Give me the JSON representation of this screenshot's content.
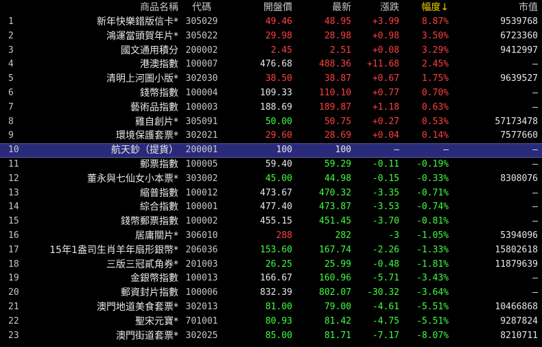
{
  "header": {
    "name": "商品名稱",
    "code": "代碼",
    "open": "開盤價",
    "last": "最新",
    "change": "漲跌",
    "pct": "幅度↓",
    "mv": "市值"
  },
  "colors": {
    "up": "#ff4040",
    "down": "#40ff40",
    "flat": "#e8e8e8",
    "selected_row": "#2a2a7a"
  },
  "rows": [
    {
      "idx": "1",
      "name": "新年快樂錯版信卡*",
      "code": "305029",
      "open": "49.46",
      "open_c": "red",
      "last": "48.95",
      "last_c": "red",
      "chg": "+3.99",
      "chg_c": "red",
      "pct": "8.87%",
      "pct_c": "red",
      "mv": "9539768"
    },
    {
      "idx": "2",
      "name": "鴻運當頭賀年片*",
      "code": "305022",
      "open": "29.98",
      "open_c": "red",
      "last": "28.98",
      "last_c": "red",
      "chg": "+0.98",
      "chg_c": "red",
      "pct": "3.50%",
      "pct_c": "red",
      "mv": "6723360"
    },
    {
      "idx": "3",
      "name": "國文通用積分",
      "code": "200002",
      "open": "2.45",
      "open_c": "red",
      "last": "2.51",
      "last_c": "red",
      "chg": "+0.08",
      "chg_c": "red",
      "pct": "3.29%",
      "pct_c": "red",
      "mv": "9412997"
    },
    {
      "idx": "4",
      "name": "港澳指數",
      "code": "100007",
      "open": "476.68",
      "open_c": "white",
      "last": "488.36",
      "last_c": "red",
      "chg": "+11.68",
      "chg_c": "red",
      "pct": "2.45%",
      "pct_c": "red",
      "mv": "—"
    },
    {
      "idx": "5",
      "name": "清明上河圖小版*",
      "code": "302030",
      "open": "38.50",
      "open_c": "red",
      "last": "38.87",
      "last_c": "red",
      "chg": "+0.67",
      "chg_c": "red",
      "pct": "1.75%",
      "pct_c": "red",
      "mv": "9639527"
    },
    {
      "idx": "6",
      "name": "錢幣指數",
      "code": "100004",
      "open": "109.33",
      "open_c": "white",
      "last": "110.10",
      "last_c": "red",
      "chg": "+0.77",
      "chg_c": "red",
      "pct": "0.70%",
      "pct_c": "red",
      "mv": "—"
    },
    {
      "idx": "7",
      "name": "藝術品指數",
      "code": "100003",
      "open": "188.69",
      "open_c": "white",
      "last": "189.87",
      "last_c": "red",
      "chg": "+1.18",
      "chg_c": "red",
      "pct": "0.63%",
      "pct_c": "red",
      "mv": "—"
    },
    {
      "idx": "8",
      "name": "雞自創片*",
      "code": "305091",
      "open": "50.00",
      "open_c": "green",
      "last": "50.75",
      "last_c": "red",
      "chg": "+0.27",
      "chg_c": "red",
      "pct": "0.53%",
      "pct_c": "red",
      "mv": "57173478"
    },
    {
      "idx": "9",
      "name": "環境保護套票*",
      "code": "302021",
      "open": "29.60",
      "open_c": "red",
      "last": "28.69",
      "last_c": "red",
      "chg": "+0.04",
      "chg_c": "red",
      "pct": "0.14%",
      "pct_c": "red",
      "mv": "7577660"
    },
    {
      "idx": "10",
      "name": "航天鈔（提貨）",
      "code": "200001",
      "open": "100",
      "open_c": "white",
      "last": "100",
      "last_c": "white",
      "chg": "—",
      "chg_c": "white",
      "pct": "—",
      "pct_c": "white",
      "mv": "—",
      "selected": true
    },
    {
      "idx": "11",
      "name": "郵票指數",
      "code": "100005",
      "open": "59.40",
      "open_c": "white",
      "last": "59.29",
      "last_c": "green",
      "chg": "-0.11",
      "chg_c": "green",
      "pct": "-0.19%",
      "pct_c": "green",
      "mv": "—"
    },
    {
      "idx": "12",
      "name": "董永與七仙女小本票*",
      "code": "303002",
      "open": "45.00",
      "open_c": "green",
      "last": "44.98",
      "last_c": "green",
      "chg": "-0.15",
      "chg_c": "green",
      "pct": "-0.33%",
      "pct_c": "green",
      "mv": "8308076"
    },
    {
      "idx": "13",
      "name": "縮普指數",
      "code": "100012",
      "open": "473.67",
      "open_c": "white",
      "last": "470.32",
      "last_c": "green",
      "chg": "-3.35",
      "chg_c": "green",
      "pct": "-0.71%",
      "pct_c": "green",
      "mv": "—"
    },
    {
      "idx": "14",
      "name": "綜合指數",
      "code": "100001",
      "open": "477.40",
      "open_c": "white",
      "last": "473.87",
      "last_c": "green",
      "chg": "-3.53",
      "chg_c": "green",
      "pct": "-0.74%",
      "pct_c": "green",
      "mv": "—"
    },
    {
      "idx": "15",
      "name": "錢幣郵票指數",
      "code": "100002",
      "open": "455.15",
      "open_c": "white",
      "last": "451.45",
      "last_c": "green",
      "chg": "-3.70",
      "chg_c": "green",
      "pct": "-0.81%",
      "pct_c": "green",
      "mv": "—"
    },
    {
      "idx": "16",
      "name": "居庸關片*",
      "code": "306010",
      "open": "288",
      "open_c": "red",
      "last": "282",
      "last_c": "green",
      "chg": "-3",
      "chg_c": "green",
      "pct": "-1.05%",
      "pct_c": "green",
      "mv": "5394096"
    },
    {
      "idx": "17",
      "name": "15年1盎司生肖羊年扇形銀幣*",
      "code": "206036",
      "open": "153.60",
      "open_c": "green",
      "last": "167.74",
      "last_c": "green",
      "chg": "-2.26",
      "chg_c": "green",
      "pct": "-1.33%",
      "pct_c": "green",
      "mv": "15802618"
    },
    {
      "idx": "18",
      "name": "三版三冠貳角券*",
      "code": "201003",
      "open": "26.25",
      "open_c": "green",
      "last": "25.99",
      "last_c": "green",
      "chg": "-0.48",
      "chg_c": "green",
      "pct": "-1.81%",
      "pct_c": "green",
      "mv": "11879639"
    },
    {
      "idx": "19",
      "name": "金銀幣指數",
      "code": "100013",
      "open": "166.67",
      "open_c": "white",
      "last": "160.96",
      "last_c": "green",
      "chg": "-5.71",
      "chg_c": "green",
      "pct": "-3.43%",
      "pct_c": "green",
      "mv": "—"
    },
    {
      "idx": "20",
      "name": "郵資封片指數",
      "code": "100006",
      "open": "832.39",
      "open_c": "white",
      "last": "802.07",
      "last_c": "green",
      "chg": "-30.32",
      "chg_c": "green",
      "pct": "-3.64%",
      "pct_c": "green",
      "mv": "—"
    },
    {
      "idx": "21",
      "name": "澳門地道美食套票*",
      "code": "302013",
      "open": "81.00",
      "open_c": "green",
      "last": "79.00",
      "last_c": "green",
      "chg": "-4.61",
      "chg_c": "green",
      "pct": "-5.51%",
      "pct_c": "green",
      "mv": "10466868"
    },
    {
      "idx": "22",
      "name": "聖宋元寶*",
      "code": "701001",
      "open": "80.93",
      "open_c": "green",
      "last": "81.42",
      "last_c": "green",
      "chg": "-4.75",
      "chg_c": "green",
      "pct": "-5.51%",
      "pct_c": "green",
      "mv": "9287824"
    },
    {
      "idx": "23",
      "name": "澳門街道套票*",
      "code": "302025",
      "open": "85.00",
      "open_c": "green",
      "last": "81.71",
      "last_c": "green",
      "chg": "-7.17",
      "chg_c": "green",
      "pct": "-8.07%",
      "pct_c": "green",
      "mv": "8210711"
    }
  ]
}
